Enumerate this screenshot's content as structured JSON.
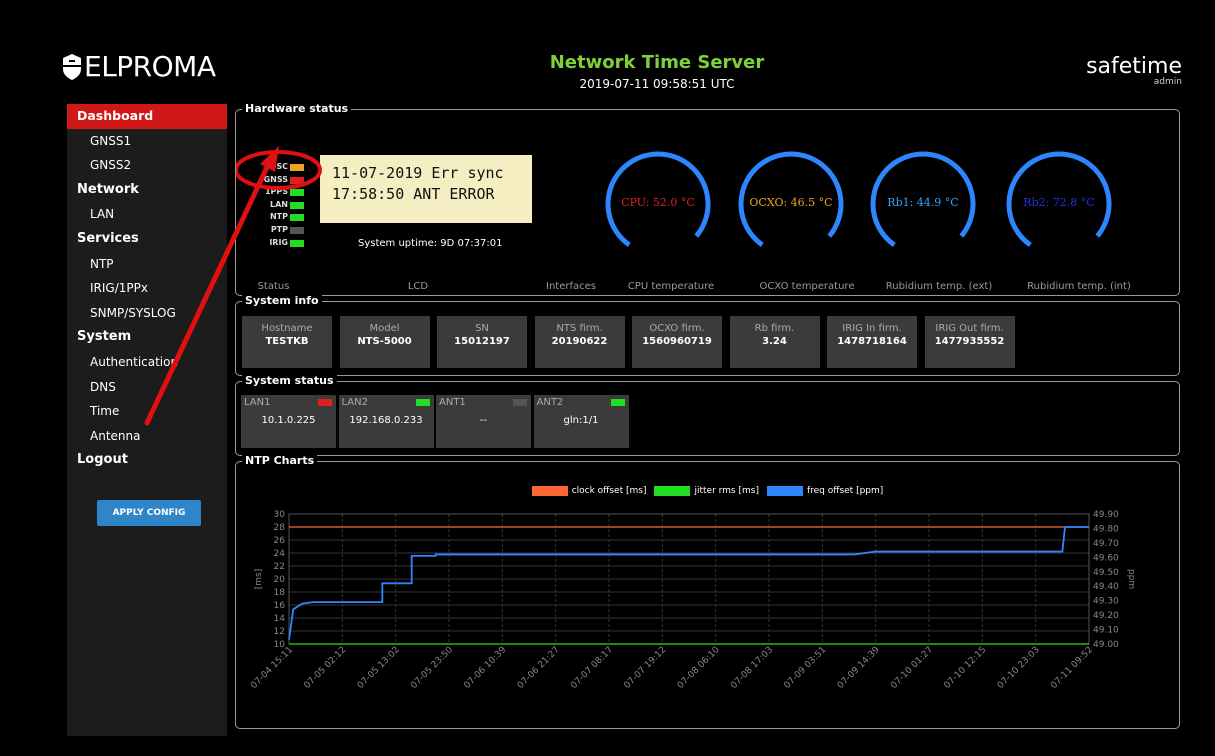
{
  "header": {
    "logo_text": "ELPROMA",
    "title": "Network Time Server",
    "datetime": "2019-07-11 09:58:51 UTC",
    "brand": "safetime",
    "user": "admin"
  },
  "sidebar": {
    "items": [
      {
        "label": "Dashboard",
        "type": "sub-active"
      },
      {
        "label": "GNSS1",
        "type": "sub"
      },
      {
        "label": "GNSS2",
        "type": "sub"
      },
      {
        "label": "Network",
        "type": "section"
      },
      {
        "label": "LAN",
        "type": "sub"
      },
      {
        "label": "Services",
        "type": "section"
      },
      {
        "label": "NTP",
        "type": "sub"
      },
      {
        "label": "IRIG/1PPx",
        "type": "sub"
      },
      {
        "label": "SNMP/SYSLOG",
        "type": "sub"
      },
      {
        "label": "System",
        "type": "section"
      },
      {
        "label": "Authentication",
        "type": "sub"
      },
      {
        "label": "DNS",
        "type": "sub"
      },
      {
        "label": "Time",
        "type": "sub"
      },
      {
        "label": "Antenna",
        "type": "sub"
      },
      {
        "label": "Logout",
        "type": "section"
      }
    ],
    "apply_button": "APPLY CONFIG"
  },
  "hardware": {
    "legend": "Hardware status",
    "indicators": [
      {
        "label": "OSC",
        "color": "#f0a020"
      },
      {
        "label": "GNSS",
        "color": "#e02020"
      },
      {
        "label": "1PPS",
        "color": "#22dd22"
      },
      {
        "label": "LAN",
        "color": "#22dd22"
      },
      {
        "label": "NTP",
        "color": "#22dd22"
      },
      {
        "label": "PTP",
        "color": "#555555"
      },
      {
        "label": "IRIG",
        "color": "#22dd22"
      }
    ],
    "lcd_line1": "11-07-2019 Err sync",
    "lcd_line2": "17:58:50 ANT ERROR",
    "uptime": "System uptime: 9D 07:37:01",
    "gauges": [
      {
        "label": "CPU: 52.0 °C",
        "color": "#e02020"
      },
      {
        "label": "OCXO: 46.5 °C",
        "color": "#f0a020"
      },
      {
        "label": "Rb1: 44.9 °C",
        "color": "#2ea6ff"
      },
      {
        "label": "Rb2: 72.8 °C",
        "color": "#2233dd"
      }
    ],
    "captions": [
      "Status",
      "LCD",
      "Interfaces",
      "CPU temperature",
      "OCXO temperature",
      "Rubidium temp. (ext)",
      "Rubidium temp. (int)"
    ]
  },
  "sysinfo": {
    "legend": "System info",
    "cards": [
      {
        "k": "Hostname",
        "v": "TESTKB"
      },
      {
        "k": "Model",
        "v": "NTS-5000"
      },
      {
        "k": "SN",
        "v": "15012197"
      },
      {
        "k": "NTS firm.",
        "v": "20190622"
      },
      {
        "k": "OCXO firm.",
        "v": "1560960719"
      },
      {
        "k": "Rb firm.",
        "v": "3.24"
      },
      {
        "k": "IRIG In firm.",
        "v": "1478718164"
      },
      {
        "k": "IRIG Out firm.",
        "v": "1477935552"
      }
    ]
  },
  "sysstatus": {
    "legend": "System status",
    "cards": [
      {
        "k": "LAN1",
        "v": "10.1.0.225",
        "led": "#e02020"
      },
      {
        "k": "LAN2",
        "v": "192.168.0.233",
        "led": "#22dd22"
      },
      {
        "k": "ANT1",
        "v": "--",
        "led": "#555555"
      },
      {
        "k": "ANT2",
        "v": "gln:1/1",
        "led": "#22dd22"
      }
    ]
  },
  "ntp": {
    "legend": "NTP Charts"
  },
  "chart_data": {
    "type": "line",
    "title": "",
    "legend_placement": "top",
    "xlabel": "",
    "ylabel": "[ms]",
    "y2label": "ppm",
    "ylim": [
      10,
      30
    ],
    "y2lim": [
      49.0,
      49.9
    ],
    "yticks": [
      10,
      12,
      14,
      16,
      18,
      20,
      22,
      24,
      26,
      28,
      30
    ],
    "y2ticks": [
      "49.00",
      "49.10",
      "49.20",
      "49.30",
      "49.40",
      "49.50",
      "49.60",
      "49.70",
      "49.80",
      "49.90"
    ],
    "x_tick_labels": [
      "07-04 15:11",
      "07-05 02:12",
      "07-05 13:02",
      "07-05 23:50",
      "07-06 10:39",
      "07-06 21:27",
      "07-07 08:17",
      "07-07 19:12",
      "07-08 06:10",
      "07-08 17:03",
      "07-09 03:51",
      "07-09 14:39",
      "07-10 01:27",
      "07-10 12:15",
      "07-10 23:03",
      "07-11 09:52"
    ],
    "grid": true,
    "series": [
      {
        "name": "clock offset [ms]",
        "color": "#ff6633",
        "axis": "left",
        "values": [
          28,
          28,
          28,
          28,
          28,
          28,
          28,
          28,
          28,
          28,
          28,
          28,
          28,
          28,
          28,
          28
        ]
      },
      {
        "name": "jitter rms [ms]",
        "color": "#22dd22",
        "axis": "left",
        "values": [
          10,
          10,
          10,
          10,
          10,
          10,
          10,
          10,
          10,
          10,
          10,
          10,
          10,
          10,
          10,
          10
        ]
      },
      {
        "name": "freq offset [ppm]",
        "color": "#2e86ff",
        "axis": "right",
        "x": [
          0,
          0.08,
          0.25,
          0.45,
          1.0,
          1.75,
          1.75,
          2.3,
          2.3,
          2.75,
          2.75,
          3.5,
          4.5,
          5.5,
          6.5,
          7.5,
          8.5,
          9.5,
          10.6,
          11.0,
          11.5,
          12.5,
          13.5,
          14.5,
          14.55,
          15.0
        ],
        "values": [
          49.03,
          49.24,
          49.28,
          49.29,
          49.29,
          49.29,
          49.42,
          49.42,
          49.61,
          49.61,
          49.62,
          49.62,
          49.62,
          49.62,
          49.62,
          49.62,
          49.62,
          49.62,
          49.62,
          49.64,
          49.64,
          49.64,
          49.64,
          49.64,
          49.81,
          49.81
        ]
      }
    ]
  }
}
